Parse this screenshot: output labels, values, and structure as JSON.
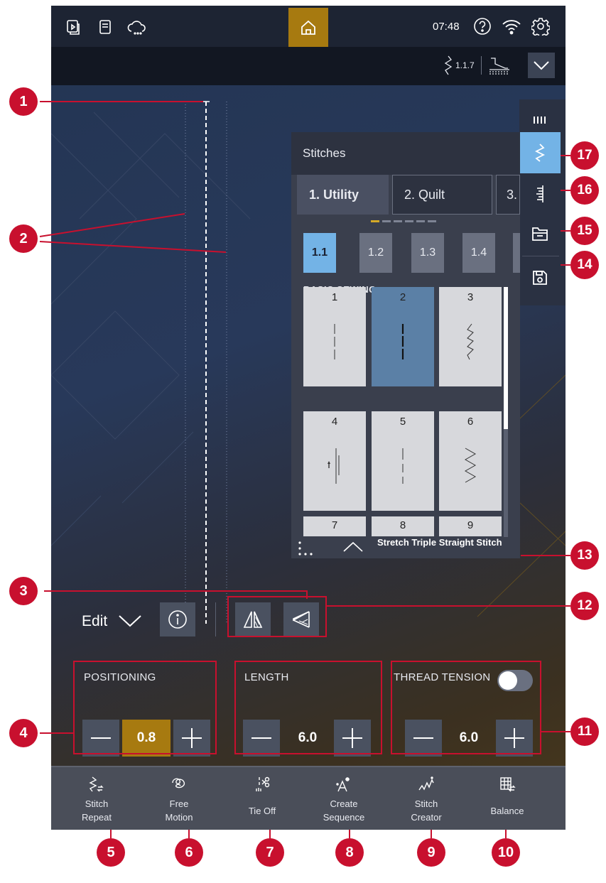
{
  "status_bar": {
    "time": "07:48",
    "icons": [
      "sewing-mode-icon",
      "manual-icon",
      "cloud-icon",
      "home-icon",
      "help-icon",
      "wifi-icon",
      "settings-icon"
    ]
  },
  "sub_bar": {
    "stitch_number": "1.1.7"
  },
  "panel": {
    "title": "Stitches",
    "tabs": [
      "1. Utility",
      "2. Quilt",
      "3."
    ],
    "subtabs": [
      "1.1",
      "1.2",
      "1.3",
      "1.4"
    ],
    "section": "BASIC SEWING",
    "stitches": [
      "1",
      "2",
      "3",
      "4",
      "5",
      "6",
      "7",
      "8",
      "9"
    ],
    "selected_stitch": "2",
    "selected_name": "Stretch Triple Straight Stitch"
  },
  "edit": {
    "label": "Edit"
  },
  "controls": {
    "positioning": {
      "label": "POSITIONING",
      "value": "0.8"
    },
    "length": {
      "label": "LENGTH",
      "value": "6.0"
    },
    "thread_tension": {
      "label": "THREAD TENSION",
      "value": "6.0",
      "enabled": false
    }
  },
  "toolbar": [
    {
      "line1": "Stitch",
      "line2": "Repeat"
    },
    {
      "line1": "Free",
      "line2": "Motion"
    },
    {
      "line1": "Tie Off",
      "line2": ""
    },
    {
      "line1": "Create",
      "line2": "Sequence"
    },
    {
      "line1": "Stitch",
      "line2": "Creator"
    },
    {
      "line1": "Balance",
      "line2": ""
    }
  ],
  "callouts": [
    "1",
    "2",
    "3",
    "4",
    "5",
    "6",
    "7",
    "8",
    "9",
    "10",
    "11",
    "12",
    "13",
    "14",
    "15",
    "16",
    "17"
  ],
  "colors": {
    "accent_gold": "#a77a10",
    "accent_blue": "#73b3e6",
    "callout_red": "#c8102e"
  }
}
